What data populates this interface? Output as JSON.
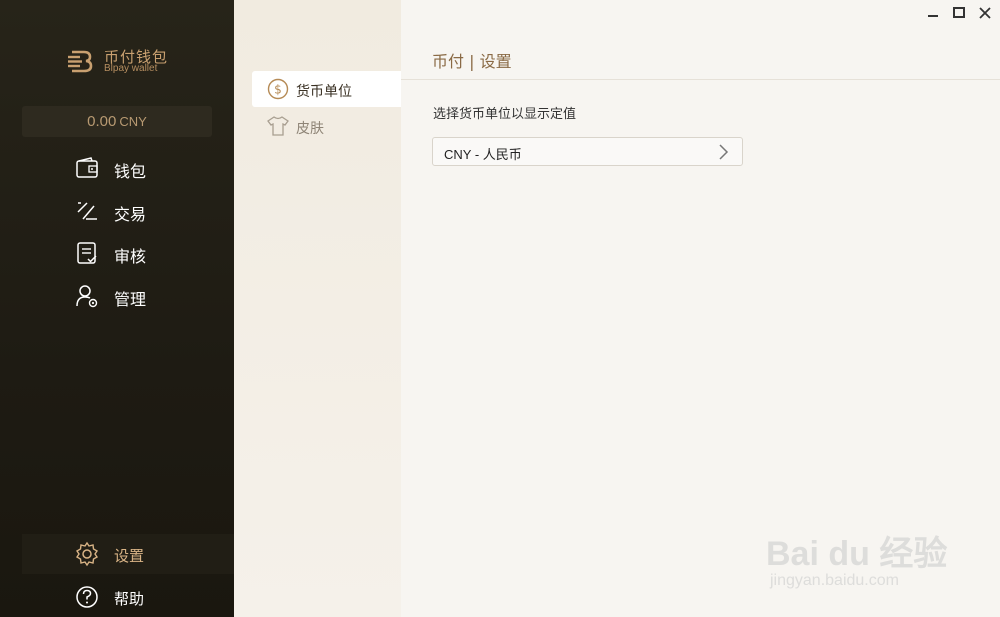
{
  "brand": {
    "name_cn": "币付钱包",
    "name_en": "Blpay wallet",
    "color": "#c9a070"
  },
  "balance": {
    "amount": "0.00",
    "unit": "CNY"
  },
  "nav": [
    {
      "label": "钱包",
      "icon": "wallet-icon"
    },
    {
      "label": "交易",
      "icon": "transaction-icon"
    },
    {
      "label": "审核",
      "icon": "review-icon"
    },
    {
      "label": "管理",
      "icon": "manage-icon"
    }
  ],
  "nav_bottom": {
    "settings": {
      "label": "设置",
      "icon": "gear-icon",
      "active": true
    },
    "help": {
      "label": "帮助",
      "icon": "help-icon"
    }
  },
  "submenu": [
    {
      "label": "货币单位",
      "icon": "currency-icon",
      "active": true
    },
    {
      "label": "皮肤",
      "icon": "shirt-icon",
      "active": false
    }
  ],
  "main": {
    "title": "币付 | 设置",
    "field_label": "选择货币单位以显示定值",
    "select_value": "CNY - 人民币"
  },
  "window_controls": [
    "minimize-icon",
    "maximize-icon",
    "close-icon"
  ],
  "watermark": {
    "logo": "Bai du 经验",
    "url": "jingyan.baidu.com"
  }
}
